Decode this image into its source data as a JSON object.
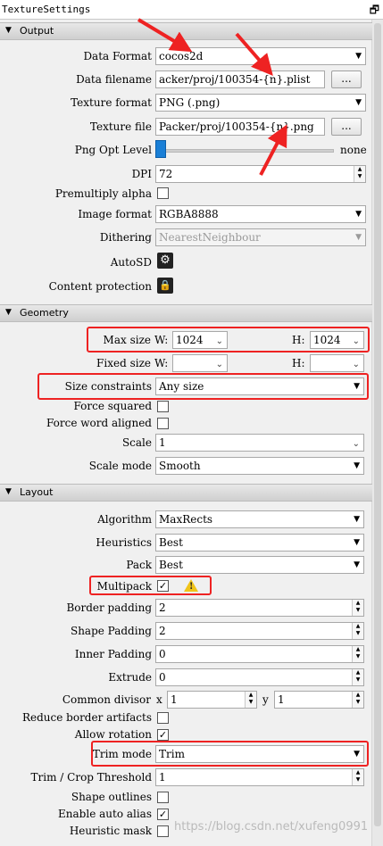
{
  "title": "TextureSettings",
  "sections": {
    "output": "Output",
    "geometry": "Geometry",
    "layout": "Layout"
  },
  "output": {
    "data_format": {
      "label": "Data Format",
      "value": "cocos2d"
    },
    "data_filename": {
      "label": "Data filename",
      "value": "acker/proj/100354-{n}.plist",
      "button": "..."
    },
    "texture_format": {
      "label": "Texture format",
      "value": "PNG (.png)"
    },
    "texture_file": {
      "label": "Texture file",
      "value": "Packer/proj/100354-{n}.png",
      "button": "..."
    },
    "png_opt_level": {
      "label": "Png Opt Level",
      "value_text": "none",
      "level": 0
    },
    "dpi": {
      "label": "DPI",
      "value": "72"
    },
    "premultiply_alpha": {
      "label": "Premultiply alpha",
      "checked": false
    },
    "image_format": {
      "label": "Image format",
      "value": "RGBA8888"
    },
    "dithering": {
      "label": "Dithering",
      "value": "NearestNeighbour",
      "disabled": true
    },
    "autosd": {
      "label": "AutoSD",
      "icon": "gear-icon"
    },
    "content_protection": {
      "label": "Content protection",
      "icon": "lock-icon"
    }
  },
  "geometry": {
    "max_size": {
      "label": "Max size",
      "w_label": "W:",
      "w_value": "1024",
      "h_label": "H:",
      "h_value": "1024"
    },
    "fixed_size": {
      "label": "Fixed size",
      "w_label": "W:",
      "w_value": "",
      "h_label": "H:",
      "h_value": ""
    },
    "size_constraints": {
      "label": "Size constraints",
      "value": "Any size"
    },
    "force_squared": {
      "label": "Force squared",
      "checked": false
    },
    "force_word_aligned": {
      "label": "Force word aligned",
      "checked": false
    },
    "scale": {
      "label": "Scale",
      "value": "1"
    },
    "scale_mode": {
      "label": "Scale mode",
      "value": "Smooth"
    }
  },
  "layout": {
    "algorithm": {
      "label": "Algorithm",
      "value": "MaxRects"
    },
    "heuristics": {
      "label": "Heuristics",
      "value": "Best"
    },
    "pack": {
      "label": "Pack",
      "value": "Best"
    },
    "multipack": {
      "label": "Multipack",
      "checked": true
    },
    "border_padding": {
      "label": "Border padding",
      "value": "2"
    },
    "shape_padding": {
      "label": "Shape Padding",
      "value": "2"
    },
    "inner_padding": {
      "label": "Inner Padding",
      "value": "0"
    },
    "extrude": {
      "label": "Extrude",
      "value": "0"
    },
    "common_divisor": {
      "label": "Common divisor",
      "x_label": "x",
      "x_value": "1",
      "y_label": "y",
      "y_value": "1"
    },
    "reduce_border_artifacts": {
      "label": "Reduce border artifacts",
      "checked": false
    },
    "allow_rotation": {
      "label": "Allow rotation",
      "checked": true
    },
    "trim_mode": {
      "label": "Trim mode",
      "value": "Trim"
    },
    "trim_threshold": {
      "label": "Trim / Crop Threshold",
      "value": "1"
    },
    "shape_outlines": {
      "label": "Shape outlines",
      "checked": false
    },
    "enable_auto_alias": {
      "label": "Enable auto alias",
      "checked": true
    },
    "heuristic_mask": {
      "label": "Heuristic mask",
      "checked": false
    }
  },
  "watermark": "https://blog.csdn.net/xufeng0991",
  "colors": {
    "annotation": "#ee2222",
    "slider": "#1a7fd6",
    "warning": "#f0c419"
  }
}
